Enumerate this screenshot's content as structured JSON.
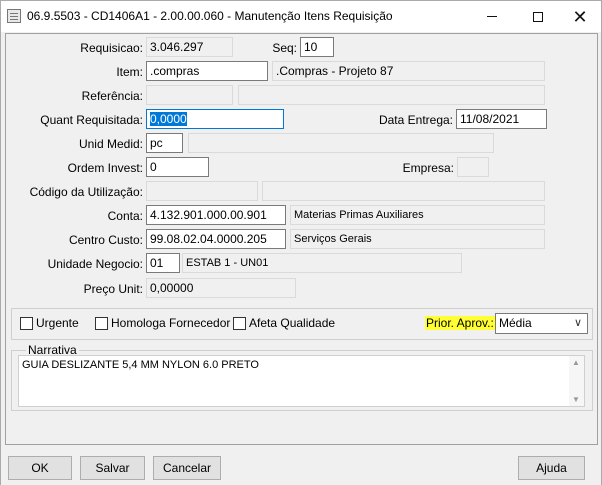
{
  "window": {
    "title": "06.9.5503 - CD1406A1 - 2.00.00.060 - Manutenção Itens Requisição"
  },
  "form": {
    "requisicao": {
      "label": "Requisicao:",
      "value": "3.046.297"
    },
    "seq": {
      "label": "Seq:",
      "value": "10"
    },
    "item": {
      "label": "Item:",
      "value": ".compras",
      "description": ".Compras - Projeto 87"
    },
    "referencia": {
      "label": "Referência:",
      "value": "",
      "description": ""
    },
    "quant_requisitada": {
      "label": "Quant Requisitada:",
      "value": "0,0000"
    },
    "data_entrega": {
      "label": "Data Entrega:",
      "value": "11/08/2021"
    },
    "unid_medid": {
      "label": "Unid Medid:",
      "value": "pc",
      "description": ""
    },
    "ordem_invest": {
      "label": "Ordem Invest:",
      "value": "0"
    },
    "empresa": {
      "label": "Empresa:",
      "value": ""
    },
    "codigo_utilizacao": {
      "label": "Código da Utilização:",
      "value": "",
      "description": ""
    },
    "conta": {
      "label": "Conta:",
      "value": "4.132.901.000.00.901",
      "description": "Materias Primas Auxiliares"
    },
    "centro_custo": {
      "label": "Centro Custo:",
      "value": "99.08.02.04.0000.205",
      "description": "Serviços Gerais"
    },
    "unidade_negocio": {
      "label": "Unidade Negocio:",
      "value": "01",
      "description": "ESTAB 1 - UN01"
    },
    "preco_unit": {
      "label": "Preço Unit:",
      "value": "0,00000"
    }
  },
  "options": {
    "urgente": {
      "label": "Urgente",
      "checked": false
    },
    "homologa_fornecedor": {
      "label": "Homologa Fornecedor",
      "checked": false
    },
    "afeta_qualidade": {
      "label": "Afeta Qualidade",
      "checked": false
    },
    "prior_aprov": {
      "label": "Prior. Aprov.:",
      "value": "Média",
      "highlight_color": "#ffff33"
    }
  },
  "narrativa": {
    "legend": "Narrativa",
    "text": "GUIA DESLIZANTE 5,4 MM NYLON 6.0 PRETO"
  },
  "buttons": {
    "ok": "OK",
    "salvar": "Salvar",
    "cancelar": "Cancelar",
    "ajuda": "Ajuda"
  },
  "colors": {
    "focus_border": "#0078d7",
    "selection": "#0078d7",
    "highlight": "#ffff33"
  }
}
